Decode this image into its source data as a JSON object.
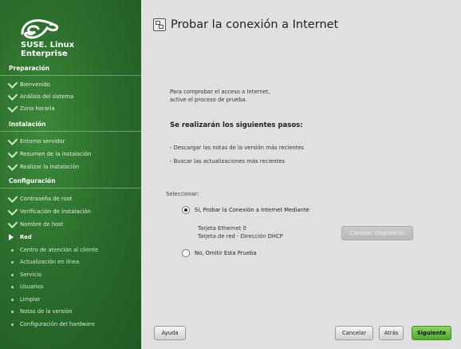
{
  "brand": {
    "line1": "SUSE. Linux",
    "line2": "Enterprise"
  },
  "sidebar": {
    "sections": [
      {
        "title": "Preparación"
      },
      {
        "title": "Instalación"
      },
      {
        "title": "Configuración"
      }
    ],
    "items": [
      {
        "label": "Bienvenido",
        "state": "done"
      },
      {
        "label": "Análisis del sistema",
        "state": "done"
      },
      {
        "label": "Zona horaria",
        "state": "done"
      },
      {
        "label": "Entorno servidor",
        "state": "done"
      },
      {
        "label": "Resumen de la instalación",
        "state": "done"
      },
      {
        "label": "Realizar la instalación",
        "state": "done"
      },
      {
        "label": "Contraseña de root",
        "state": "done"
      },
      {
        "label": "Verificación de instalación",
        "state": "done"
      },
      {
        "label": "Nombre de host",
        "state": "done"
      },
      {
        "label": "Red",
        "state": "current"
      },
      {
        "label": "Centro de atención al cliente",
        "state": "pending"
      },
      {
        "label": "Actualización en línea",
        "state": "pending"
      },
      {
        "label": "Servicio",
        "state": "pending"
      },
      {
        "label": "Usuarios",
        "state": "pending"
      },
      {
        "label": "Limpiar",
        "state": "pending"
      },
      {
        "label": "Notas de la versión",
        "state": "pending"
      },
      {
        "label": "Configuración del hardware",
        "state": "pending"
      }
    ]
  },
  "main": {
    "title": "Probar la conexión a Internet",
    "intro1": "Para comprobar el acceso a Internet,",
    "intro2": "active el proceso de prueba.",
    "steps_heading": "Se realizarán los siguientes pasos:",
    "step1": "- Descargar las notas de la versión más recientes",
    "step2": "- Buscar las actualizaciones más recientes",
    "select_label": "Seleccionar:",
    "option_yes": "Sí, Probar la Conexión a Internet Mediante",
    "device1": "Tarjeta Ethernet 0",
    "device2": "Tarjeta de red - Dirección DHCP",
    "change_device": "Cambiar Dispositivo",
    "option_no": "No, Omitir Esta Prueba"
  },
  "buttons": {
    "help": "Ayuda",
    "cancel": "Cancelar",
    "back": "Atrás",
    "next": "Siguiente"
  },
  "colors": {
    "sidebar_green": "#2b6e2b",
    "accent_green": "#4eaa2b"
  },
  "icons": {
    "brand": "suse-chameleon-logo",
    "title": "network-computers-icon"
  }
}
